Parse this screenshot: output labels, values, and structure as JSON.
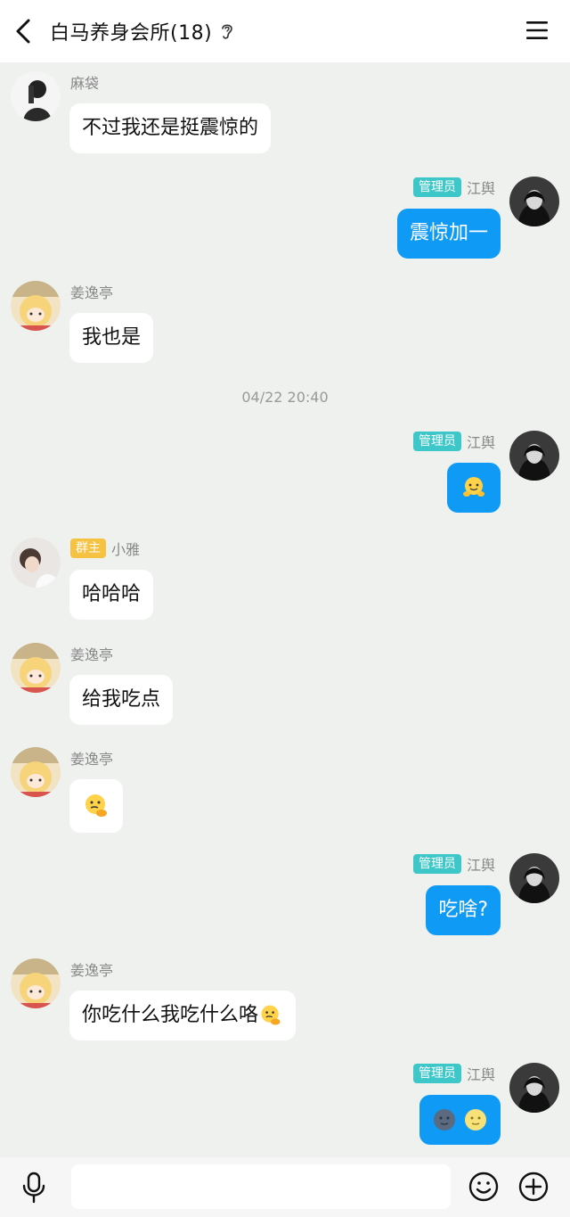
{
  "header": {
    "title": "白马养身会所(18)"
  },
  "messages": {
    "m1": {
      "sender": "麻袋",
      "text": "不过我还是挺震惊的"
    },
    "m2": {
      "badge": "管理员",
      "sender": "江舆",
      "text": "震惊加一"
    },
    "m3": {
      "sender": "姜逸亭",
      "text": "我也是"
    },
    "m4": {
      "badge": "管理员",
      "sender": "江舆"
    },
    "m5": {
      "badge": "群主",
      "sender": "小雅",
      "text": "哈哈哈"
    },
    "m6": {
      "sender": "姜逸亭",
      "text": "给我吃点"
    },
    "m7": {
      "sender": "姜逸亭"
    },
    "m8": {
      "badge": "管理员",
      "sender": "江舆",
      "text": "吃啥?"
    },
    "m9": {
      "sender": "姜逸亭",
      "text": "你吃什么我吃什么咯"
    },
    "m10": {
      "badge": "管理员",
      "sender": "江舆"
    }
  },
  "timestamp": "04/22 20:40",
  "input": {
    "placeholder": ""
  },
  "colors": {
    "accent_bubble": "#0f9af5",
    "admin_badge": "#3ec7c9",
    "owner_badge": "#f6c241",
    "chat_bg": "#eef1ee"
  },
  "icons": [
    "back-arrow-icon",
    "ear-icon",
    "menu-icon",
    "mic-icon",
    "smiley-icon",
    "plus-icon"
  ]
}
